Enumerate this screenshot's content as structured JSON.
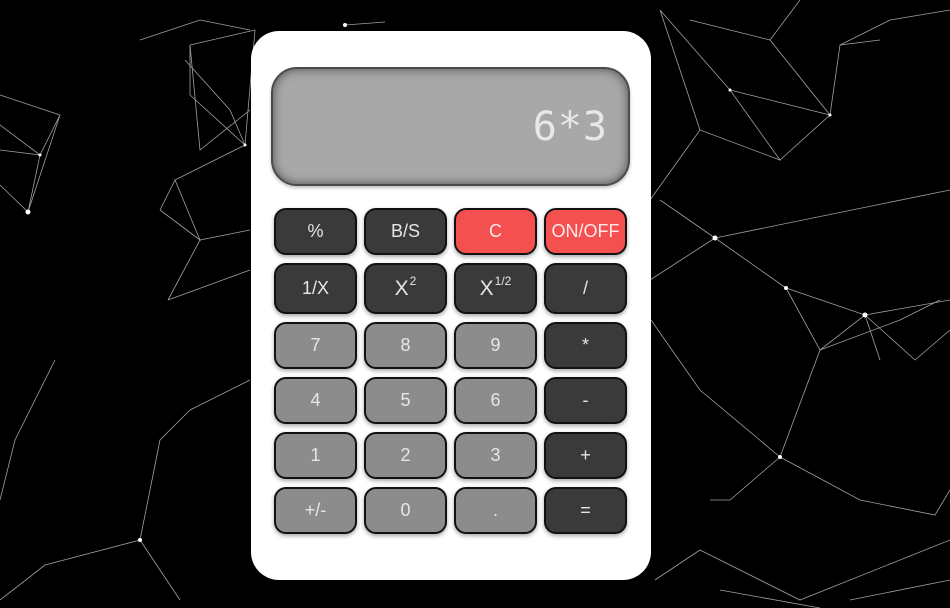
{
  "display": {
    "value": "6*3"
  },
  "colors": {
    "background": "#000000",
    "body": "#ffffff",
    "screen": "#a8a8a8",
    "function_key": "#3a3a3a",
    "digit_key": "#8c8c8c",
    "clear_key": "#f45050"
  },
  "keys": {
    "percent": "%",
    "backspace": "B/S",
    "clear": "C",
    "onoff": "ON/OFF",
    "reciprocal": "1/X",
    "square_base": "X",
    "square_exp": "2",
    "sqrt_base": "X",
    "sqrt_exp": "1/2",
    "divide": "/",
    "seven": "7",
    "eight": "8",
    "nine": "9",
    "multiply": "*",
    "four": "4",
    "five": "5",
    "six": "6",
    "minus": "-",
    "one": "1",
    "two": "2",
    "three": "3",
    "plus": "+",
    "negate": "+/-",
    "zero": "0",
    "decimal": ".",
    "equals": "="
  }
}
